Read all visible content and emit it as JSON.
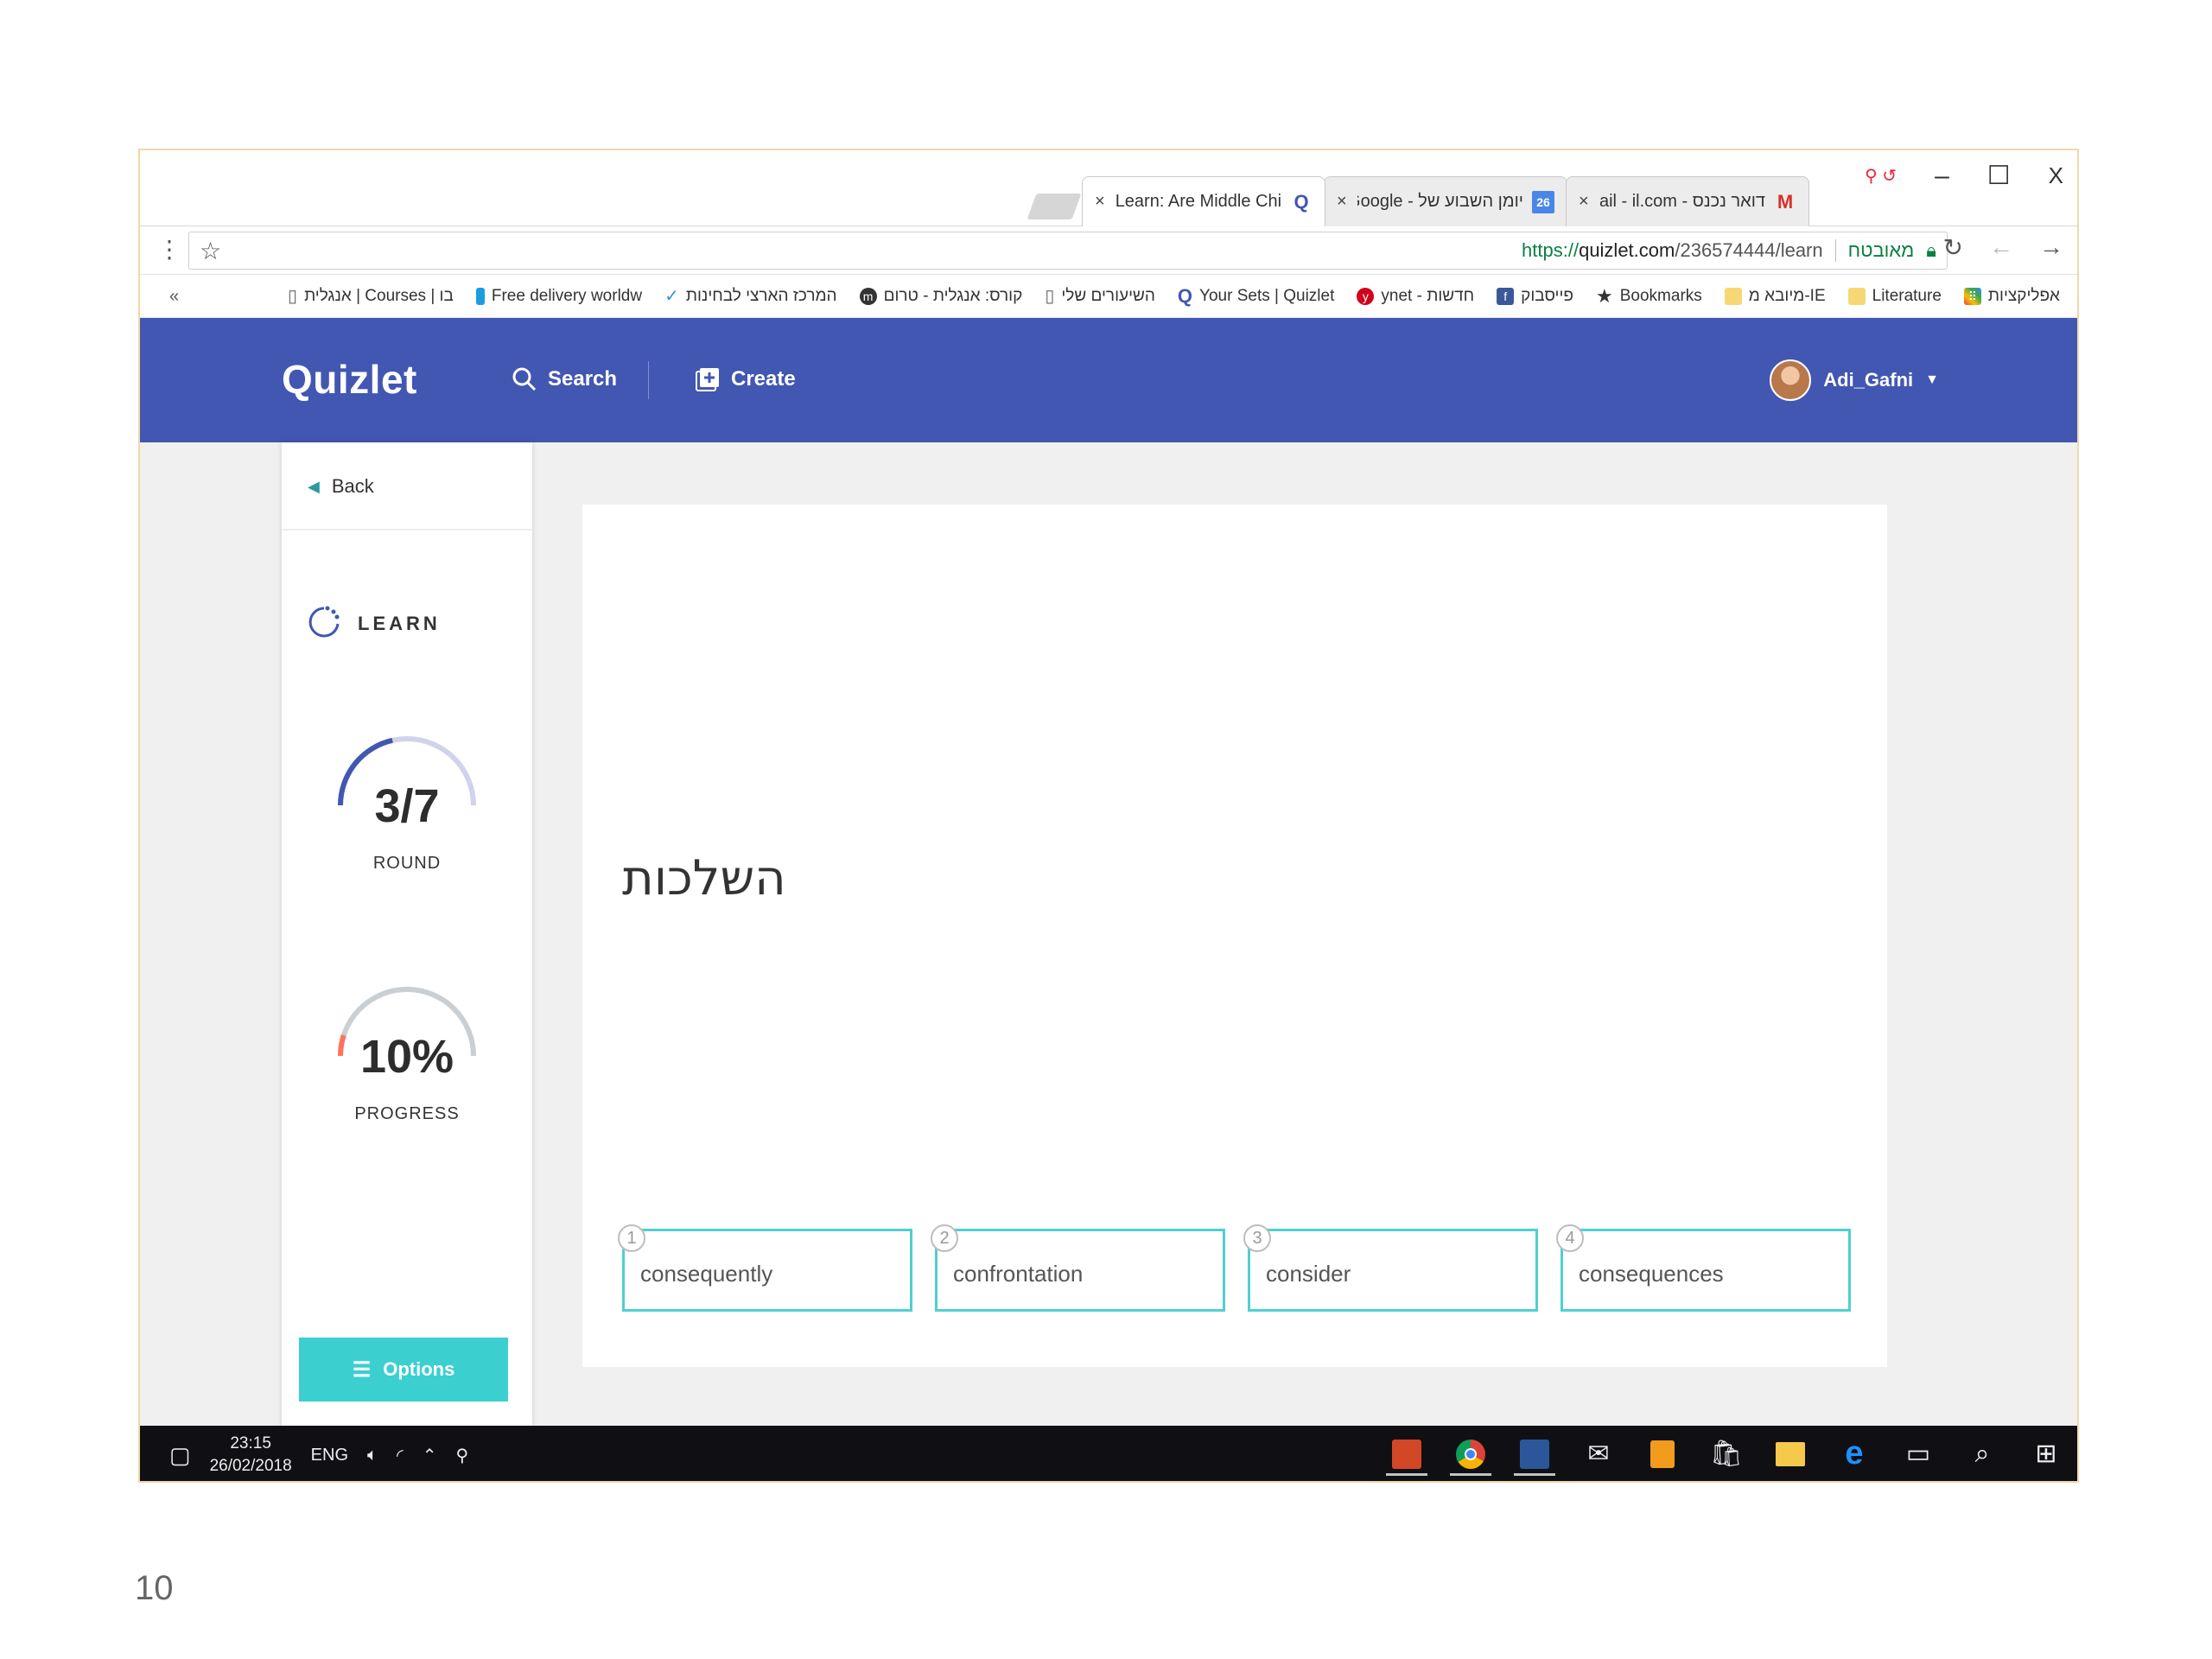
{
  "browser": {
    "tabs": [
      {
        "title": "Learn: Are Middle Childr",
        "icon": "quizlet-q-icon",
        "active": true
      },
      {
        "title": "יומן השבוע של - Google",
        "icon": "calendar-icon",
        "active": false
      },
      {
        "title": "דואר נכנס - Gmail - il.com",
        "icon": "gmail-icon",
        "active": false
      }
    ],
    "window_controls": {
      "minimize": "–",
      "maximize": "☐",
      "close": "X"
    },
    "address": {
      "scheme": "https://",
      "host": "quizlet.com",
      "path": "/236574444/learn",
      "secure_label": "מאובטח"
    },
    "bookmarks": [
      {
        "label": "אפליקציות",
        "icon": "apps-grid-icon"
      },
      {
        "label": "Literature",
        "icon": "folder-icon"
      },
      {
        "label": "מיובא מ-IE",
        "icon": "folder-icon"
      },
      {
        "label": "Bookmarks",
        "icon": "star-icon"
      },
      {
        "label": "פייסבוק",
        "icon": "facebook-icon"
      },
      {
        "label": "ynet - חדשות",
        "icon": "ynet-icon"
      },
      {
        "label": "Your Sets | Quizlet",
        "icon": "quizlet-q-icon"
      },
      {
        "label": "השיעורים שלי",
        "icon": "page-icon"
      },
      {
        "label": "קורס: אנגלית - טרום",
        "icon": "moodle-icon"
      },
      {
        "label": "המרכז הארצי לבחינות",
        "icon": "check-icon"
      },
      {
        "label": "Free delivery worldw",
        "icon": "book-icon"
      },
      {
        "label": "אנגלית | Courses | בו",
        "icon": "page-icon"
      }
    ]
  },
  "quizlet": {
    "logo": "Quizlet",
    "nav_search": "Search",
    "nav_create": "Create",
    "username": "Adi_Gafni",
    "back": "Back",
    "mode": "LEARN",
    "round_value": "3/7",
    "round_label": "ROUND",
    "round_fraction": 0.43,
    "progress_value": "10%",
    "progress_label": "PROGRESS",
    "progress_fraction": 0.1,
    "options": "Options",
    "question": "השלכות",
    "answers": [
      {
        "num": "1",
        "text": "consequently"
      },
      {
        "num": "2",
        "text": "confrontation"
      },
      {
        "num": "3",
        "text": "consider"
      },
      {
        "num": "4",
        "text": "consequences"
      }
    ],
    "colors": {
      "header": "#4257b2",
      "accent": "#3ccfcf",
      "gauge_round": "#4257b2",
      "gauge_progress": "#ff725b"
    }
  },
  "taskbar": {
    "time": "23:15",
    "date": "26/02/2018",
    "lang": "ENG"
  },
  "slide_number": "10"
}
